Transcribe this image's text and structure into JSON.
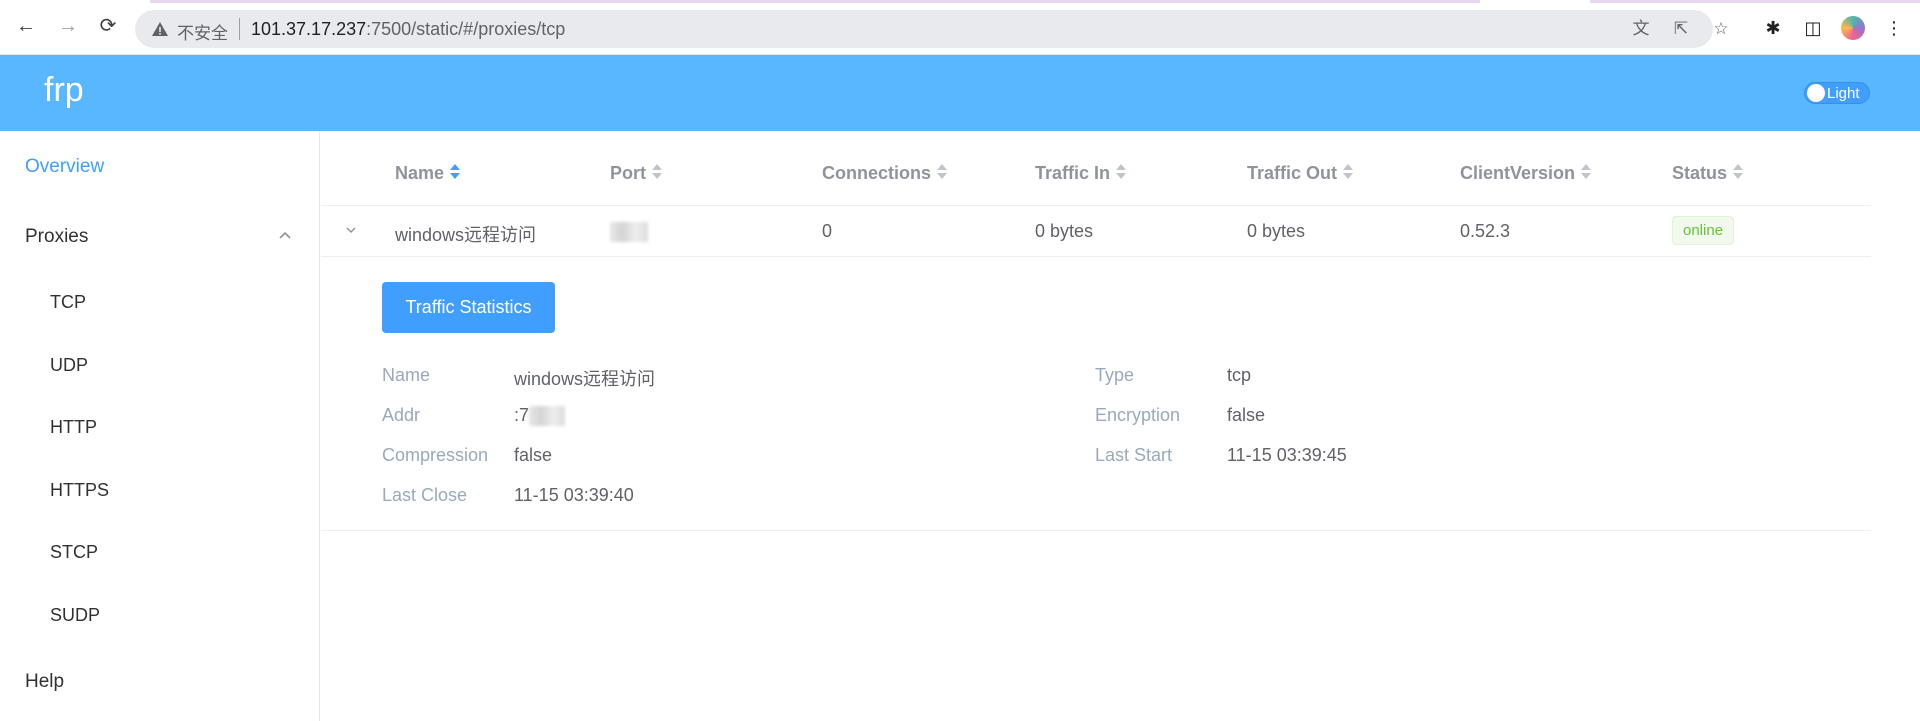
{
  "browser": {
    "insecure_label": "不安全",
    "url_host": "101.37.17.237",
    "url_rest": ":7500/static/#/proxies/tcp"
  },
  "header": {
    "brand": "frp",
    "theme_label": "Light"
  },
  "sidebar": {
    "overview": "Overview",
    "proxies": "Proxies",
    "sub_items": [
      "TCP",
      "UDP",
      "HTTP",
      "HTTPS",
      "STCP",
      "SUDP"
    ],
    "help": "Help"
  },
  "table": {
    "columns": [
      "Name",
      "Port",
      "Connections",
      "Traffic In",
      "Traffic Out",
      "ClientVersion",
      "Status"
    ],
    "row": {
      "name": "windows远程访问",
      "port": "",
      "connections": "0",
      "traffic_in": "0 bytes",
      "traffic_out": "0 bytes",
      "client_version": "0.52.3",
      "status": "online"
    }
  },
  "details": {
    "button_label": "Traffic Statistics",
    "name_label": "Name",
    "name_value": "windows远程访问",
    "addr_label": "Addr",
    "addr_value": ":7",
    "compression_label": "Compression",
    "compression_value": "false",
    "last_close_label": "Last Close",
    "last_close_value": "11-15 03:39:40",
    "type_label": "Type",
    "type_value": "tcp",
    "encryption_label": "Encryption",
    "encryption_value": "false",
    "last_start_label": "Last Start",
    "last_start_value": "11-15 03:39:45"
  },
  "colors": {
    "header_bg": "#58b7ff",
    "accent": "#409eff",
    "online": "#67c23a"
  }
}
